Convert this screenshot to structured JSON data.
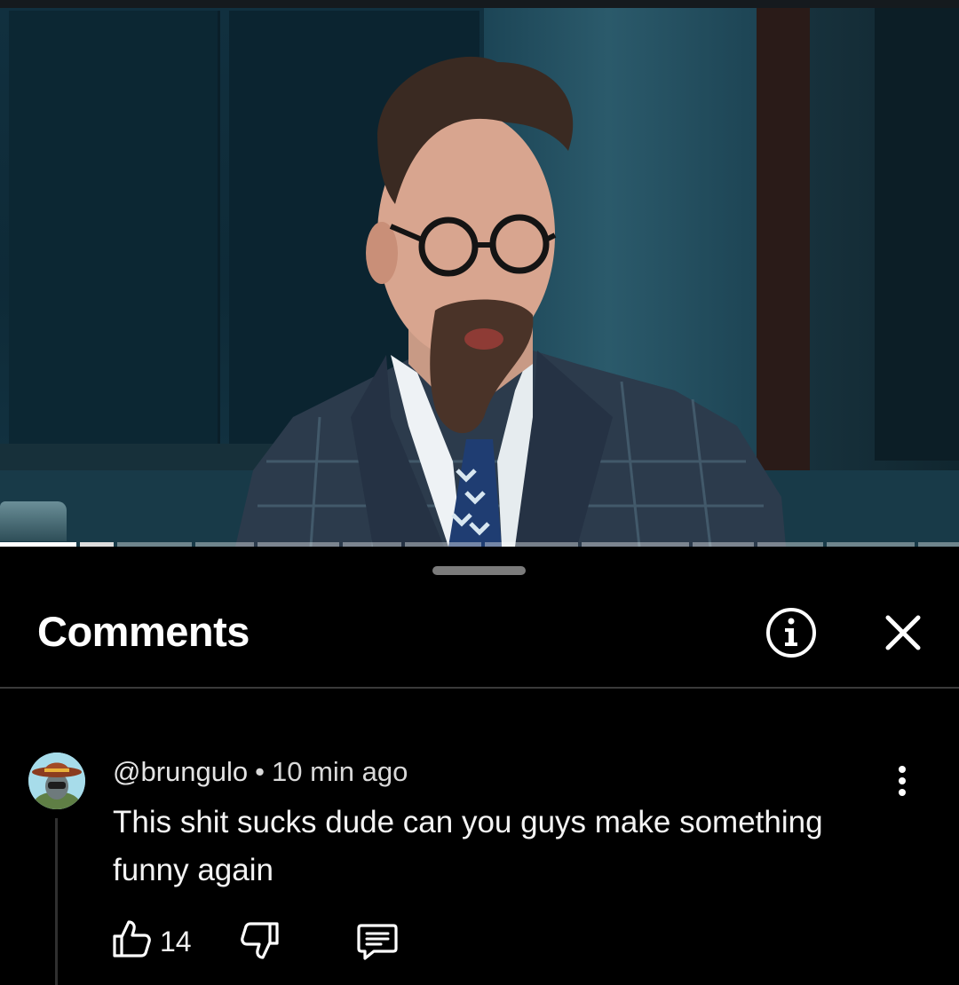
{
  "video": {
    "progress": {
      "played_fraction": 0.14,
      "segments": 13
    }
  },
  "comments_panel": {
    "title": "Comments",
    "icons": {
      "info": "info-icon",
      "close": "close-icon",
      "handle": "drag-handle"
    }
  },
  "comment": {
    "author": "@brungulo",
    "separator": "•",
    "time": "10 min ago",
    "text": "This shit sucks dude can you guys make something funny again",
    "likes": "14",
    "icons": {
      "like": "thumbs-up-icon",
      "dislike": "thumbs-down-icon",
      "reply": "reply-comment-icon",
      "more": "more-vertical-icon"
    }
  },
  "colors": {
    "background": "#000000",
    "text": "#ffffff",
    "secondary_text": "#d9d9d9",
    "divider": "#3a3a3a"
  }
}
